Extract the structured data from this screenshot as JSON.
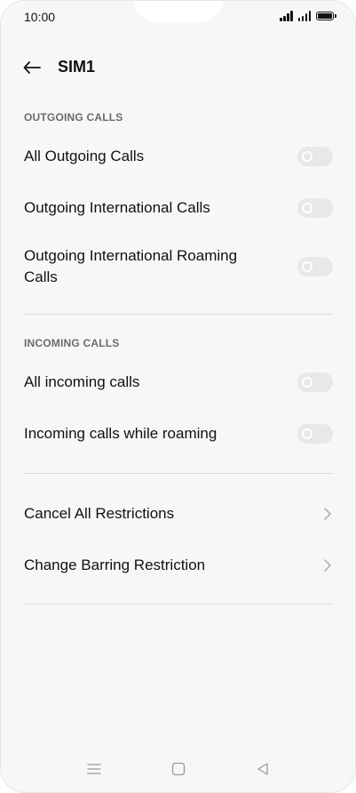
{
  "status_bar": {
    "time": "10:00"
  },
  "header": {
    "title": "SIM1"
  },
  "sections": {
    "outgoing": {
      "label": "OUTGOING CALLS",
      "items": [
        {
          "label": "All Outgoing Calls",
          "enabled": false
        },
        {
          "label": "Outgoing International Calls",
          "enabled": false
        },
        {
          "label": "Outgoing International Roaming Calls",
          "enabled": false
        }
      ]
    },
    "incoming": {
      "label": "INCOMING CALLS",
      "items": [
        {
          "label": "All incoming calls",
          "enabled": false
        },
        {
          "label": "Incoming calls while roaming",
          "enabled": false
        }
      ]
    },
    "actions": {
      "items": [
        {
          "label": "Cancel All Restrictions"
        },
        {
          "label": "Change Barring Restriction"
        }
      ]
    }
  },
  "colors": {
    "background": "#f7f7f7",
    "text": "#111111",
    "section_label": "#6b6b6b",
    "toggle_off": "#e8e8e8",
    "divider": "#dedede"
  },
  "icons": {
    "back": "arrow-left-icon",
    "chevron": "chevron-right-icon",
    "nav_menu": "menu-icon",
    "nav_home": "square-home-icon",
    "nav_back": "triangle-back-icon"
  }
}
